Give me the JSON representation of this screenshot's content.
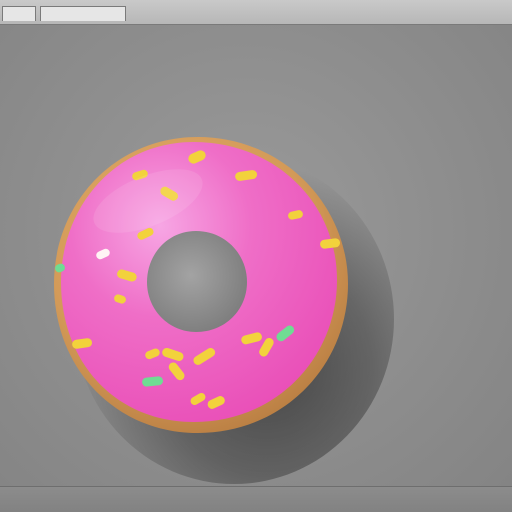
{
  "window": {
    "tabs": [
      "",
      ""
    ],
    "left_label": "",
    "right_buttons": [
      "",
      ""
    ],
    "right_sub": ""
  },
  "status": {
    "left": "",
    "right": ""
  },
  "object": {
    "name": "donut",
    "icon": "donut-icon"
  },
  "colors": {
    "background": "#8b8b8b",
    "frosting": "#f06dc5",
    "dough": "#d7a05f",
    "sprinkle_yellow": "#f2d23c",
    "sprinkle_green": "#6fdc93",
    "sprinkle_white": "#fff4f4"
  }
}
